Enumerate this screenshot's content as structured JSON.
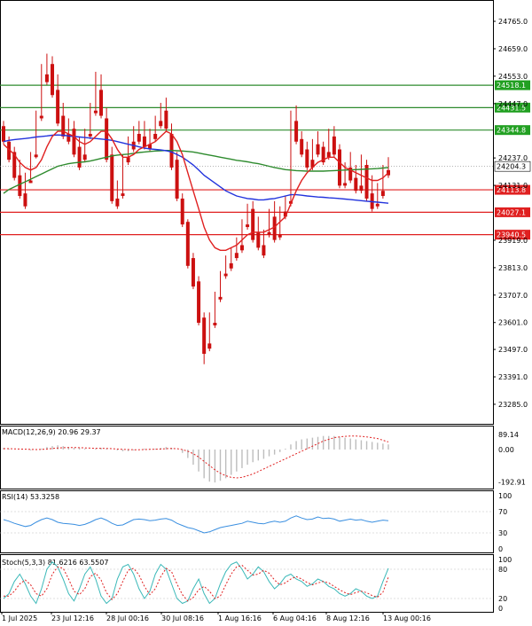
{
  "chart_data": {
    "type": "candlestick",
    "main": {
      "y_ticks": [
        "24765.0",
        "24659.0",
        "24553.0",
        "24447.0",
        "24237.0",
        "24131.0",
        "23919.0",
        "23813.0",
        "23707.0",
        "23601.0",
        "23497.0",
        "23391.0",
        "23285.0"
      ],
      "ylim": [
        23230,
        24820
      ],
      "current_price": "24204.3",
      "levels": [
        {
          "label": "24518.1",
          "value": 24518.1,
          "color": "#2e8b2e",
          "label_color": "#22a022"
        },
        {
          "label": "24431.5",
          "value": 24431.5,
          "color": "#2e8b2e",
          "label_color": "#22a022"
        },
        {
          "label": "24344.8",
          "value": 24344.8,
          "color": "#2e8b2e",
          "label_color": "#22a022"
        },
        {
          "label": "24113.8",
          "value": 24113.8,
          "color": "#e02020",
          "label_color": "#e02020"
        },
        {
          "label": "24027.1",
          "value": 24027.1,
          "color": "#e02020",
          "label_color": "#e02020"
        },
        {
          "label": "23940.5",
          "value": 23940.5,
          "color": "#e02020",
          "label_color": "#e02020"
        }
      ],
      "up_color": "#1f9a1f",
      "down_color": "#cc1010",
      "candles": [
        [
          24360,
          24380,
          24300,
          24290
        ],
        [
          24300,
          24320,
          24230,
          24220
        ],
        [
          24260,
          24280,
          24160,
          24150
        ],
        [
          24170,
          24230,
          24090,
          24080
        ],
        [
          24100,
          24180,
          24050,
          24040
        ],
        [
          24150,
          24260,
          24140,
          24140
        ],
        [
          24250,
          24420,
          24240,
          24235
        ],
        [
          24400,
          24600,
          24390,
          24380
        ],
        [
          24560,
          24640,
          24530,
          24520
        ],
        [
          24600,
          24630,
          24480,
          24470
        ],
        [
          24500,
          24560,
          24370,
          24360
        ],
        [
          24400,
          24450,
          24320,
          24310
        ],
        [
          24330,
          24390,
          24300,
          24290
        ],
        [
          24350,
          24380,
          24250,
          24240
        ],
        [
          24280,
          24320,
          24200,
          24190
        ],
        [
          24250,
          24350,
          24230,
          24220
        ],
        [
          24330,
          24450,
          24320,
          24310
        ],
        [
          24420,
          24570,
          24410,
          24400
        ],
        [
          24500,
          24560,
          24400,
          24390
        ],
        [
          24390,
          24430,
          24230,
          24220
        ],
        [
          24250,
          24280,
          24070,
          24060
        ],
        [
          24080,
          24150,
          24050,
          24040
        ],
        [
          24100,
          24250,
          24090,
          24080
        ],
        [
          24240,
          24320,
          24220,
          24210
        ],
        [
          24300,
          24360,
          24270,
          24260
        ],
        [
          24330,
          24380,
          24300,
          24290
        ],
        [
          24320,
          24380,
          24280,
          24270
        ],
        [
          24290,
          24350,
          24270,
          24260
        ],
        [
          24330,
          24400,
          24310,
          24300
        ],
        [
          24380,
          24450,
          24360,
          24350
        ],
        [
          24420,
          24470,
          24350,
          24340
        ],
        [
          24330,
          24370,
          24200,
          24190
        ],
        [
          24230,
          24260,
          24080,
          24070
        ],
        [
          24080,
          24100,
          23980,
          23970
        ],
        [
          23990,
          24000,
          23820,
          23810
        ],
        [
          23850,
          23870,
          23740,
          23730
        ],
        [
          23760,
          23780,
          23600,
          23590
        ],
        [
          23620,
          23640,
          23480,
          23440
        ],
        [
          23520,
          23640,
          23500,
          23490
        ],
        [
          23600,
          23720,
          23590,
          23580
        ],
        [
          23700,
          23800,
          23690,
          23680
        ],
        [
          23790,
          23860,
          23780,
          23770
        ],
        [
          23830,
          23890,
          23810,
          23800
        ],
        [
          23870,
          23930,
          23850,
          23840
        ],
        [
          23900,
          24000,
          23880,
          23870
        ],
        [
          23980,
          24060,
          23970,
          23960
        ],
        [
          24040,
          24070,
          23920,
          23910
        ],
        [
          23950,
          24010,
          23890,
          23880
        ],
        [
          23900,
          23960,
          23860,
          23850
        ],
        [
          23950,
          24040,
          23940,
          23930
        ],
        [
          24010,
          24070,
          23920,
          23910
        ],
        [
          23940,
          24050,
          23930,
          23920
        ],
        [
          24030,
          24090,
          24010,
          24000
        ],
        [
          24070,
          24420,
          24060,
          24050
        ],
        [
          24380,
          24440,
          24300,
          24290
        ],
        [
          24310,
          24340,
          24250,
          24240
        ],
        [
          24270,
          24300,
          24200,
          24190
        ],
        [
          24230,
          24310,
          24200,
          24190
        ],
        [
          24290,
          24340,
          24250,
          24240
        ],
        [
          24280,
          24300,
          24220,
          24210
        ],
        [
          24260,
          24350,
          24240,
          24230
        ],
        [
          24320,
          24360,
          24250,
          24240
        ],
        [
          24270,
          24290,
          24130,
          24120
        ],
        [
          24140,
          24220,
          24130,
          24120
        ],
        [
          24200,
          24260,
          24150,
          24140
        ],
        [
          24160,
          24210,
          24110,
          24100
        ],
        [
          24130,
          24250,
          24110,
          24100
        ],
        [
          24210,
          24230,
          24080,
          24070
        ],
        [
          24100,
          24170,
          24040,
          24030
        ],
        [
          24060,
          24140,
          24050,
          24040
        ],
        [
          24110,
          24210,
          24090,
          24080
        ],
        [
          24190,
          24240,
          24170,
          24160
        ]
      ],
      "ma_red": [
        24290,
        24270,
        24250,
        24220,
        24200,
        24190,
        24200,
        24230,
        24280,
        24320,
        24340,
        24340,
        24330,
        24320,
        24300,
        24290,
        24300,
        24320,
        24340,
        24340,
        24310,
        24270,
        24240,
        24240,
        24250,
        24270,
        24280,
        24290,
        24300,
        24320,
        24340,
        24330,
        24300,
        24250,
        24180,
        24110,
        24040,
        23970,
        23920,
        23890,
        23880,
        23880,
        23890,
        23900,
        23920,
        23940,
        23950,
        23950,
        23950,
        23960,
        23970,
        23990,
        24010,
        24060,
        24110,
        24150,
        24180,
        24200,
        24220,
        24230,
        24240,
        24240,
        24220,
        24200,
        24190,
        24180,
        24170,
        24160,
        24150,
        24150,
        24160,
        24180
      ],
      "ma_blue": [
        24300,
        24305,
        24308,
        24310,
        24312,
        24315,
        24318,
        24320,
        24322,
        24325,
        24326,
        24325,
        24322,
        24320,
        24318,
        24316,
        24314,
        24312,
        24310,
        24308,
        24305,
        24300,
        24295,
        24290,
        24285,
        24280,
        24275,
        24272,
        24270,
        24268,
        24265,
        24260,
        24250,
        24240,
        24225,
        24210,
        24190,
        24170,
        24155,
        24140,
        24125,
        24110,
        24100,
        24090,
        24085,
        24080,
        24078,
        24075,
        24075,
        24078,
        24080,
        24085,
        24090,
        24095,
        24095,
        24093,
        24090,
        24088,
        24086,
        24085,
        24083,
        24082,
        24080,
        24078,
        24076,
        24074,
        24072,
        24070,
        24068,
        24066,
        24064,
        24062
      ],
      "ma_green": [
        24100,
        24115,
        24125,
        24135,
        24145,
        24155,
        24165,
        24175,
        24185,
        24195,
        24205,
        24210,
        24215,
        24218,
        24220,
        24222,
        24225,
        24230,
        24235,
        24240,
        24245,
        24248,
        24250,
        24252,
        24255,
        24258,
        24260,
        24262,
        24264,
        24265,
        24266,
        24266,
        24265,
        24264,
        24262,
        24260,
        24256,
        24252,
        24248,
        24244,
        24240,
        24236,
        24232,
        24228,
        24225,
        24222,
        24218,
        24215,
        24210,
        24205,
        24200,
        24196,
        24192,
        24190,
        24188,
        24187,
        24186,
        24186,
        24186,
        24186,
        24187,
        24188,
        24189,
        24190,
        24191,
        24192,
        24193,
        24194,
        24195,
        24196,
        24198,
        24200
      ]
    },
    "macd": {
      "label": "MACD(12,26,9) 20.96 29.37",
      "y_ticks": [
        "89.14",
        "0.00",
        "-192.91"
      ],
      "ylim": [
        -210,
        110
      ],
      "hist": [
        10,
        5,
        0,
        0,
        0,
        -5,
        0,
        5,
        15,
        20,
        25,
        20,
        15,
        10,
        10,
        5,
        0,
        5,
        10,
        5,
        0,
        -5,
        -10,
        -10,
        -5,
        0,
        5,
        5,
        5,
        10,
        15,
        10,
        0,
        -20,
        -50,
        -90,
        -130,
        -170,
        -190,
        -195,
        -185,
        -170,
        -150,
        -130,
        -110,
        -90,
        -75,
        -65,
        -55,
        -40,
        -30,
        -15,
        5,
        30,
        50,
        60,
        65,
        70,
        75,
        80,
        80,
        80,
        75,
        70,
        65,
        60,
        55,
        50,
        45,
        40,
        35,
        30
      ],
      "signal": [
        5,
        5,
        4,
        3,
        2,
        1,
        0,
        1,
        3,
        6,
        9,
        11,
        12,
        12,
        11,
        10,
        8,
        7,
        7,
        6,
        5,
        3,
        1,
        0,
        -1,
        -1,
        0,
        1,
        2,
        3,
        5,
        6,
        5,
        0,
        -10,
        -25,
        -45,
        -70,
        -95,
        -120,
        -140,
        -155,
        -165,
        -168,
        -165,
        -155,
        -145,
        -130,
        -115,
        -100,
        -85,
        -70,
        -55,
        -40,
        -25,
        -10,
        5,
        20,
        35,
        50,
        60,
        70,
        75,
        78,
        80,
        80,
        78,
        75,
        70,
        65,
        55,
        45
      ]
    },
    "rsi": {
      "label": "RSI(14) 53.3258",
      "y_ticks": [
        "100",
        "70",
        "30",
        "0"
      ],
      "ylim": [
        0,
        100
      ],
      "values": [
        55,
        52,
        48,
        45,
        42,
        44,
        50,
        55,
        58,
        55,
        50,
        48,
        47,
        46,
        44,
        46,
        50,
        55,
        58,
        54,
        48,
        44,
        45,
        50,
        55,
        56,
        55,
        53,
        54,
        56,
        57,
        54,
        48,
        44,
        40,
        38,
        34,
        30,
        32,
        36,
        40,
        42,
        44,
        46,
        48,
        52,
        50,
        48,
        47,
        50,
        52,
        50,
        52,
        58,
        62,
        58,
        55,
        56,
        60,
        57,
        58,
        56,
        52,
        54,
        56,
        54,
        55,
        52,
        50,
        52,
        54,
        53
      ]
    },
    "stoch": {
      "label": "Stoch(5,3,3) 81.6216 63.5507",
      "y_ticks": [
        "100",
        "80",
        "20",
        "0"
      ],
      "ylim": [
        0,
        100
      ],
      "k": [
        20,
        30,
        55,
        70,
        50,
        25,
        10,
        40,
        80,
        95,
        85,
        60,
        30,
        15,
        40,
        70,
        85,
        60,
        25,
        10,
        20,
        60,
        85,
        90,
        70,
        40,
        20,
        35,
        70,
        90,
        80,
        50,
        20,
        10,
        15,
        40,
        60,
        30,
        10,
        20,
        50,
        75,
        90,
        95,
        80,
        60,
        70,
        85,
        75,
        55,
        40,
        50,
        65,
        70,
        60,
        55,
        45,
        50,
        60,
        55,
        45,
        40,
        30,
        25,
        30,
        40,
        35,
        25,
        20,
        25,
        55,
        82
      ],
      "d": [
        25,
        25,
        35,
        50,
        58,
        48,
        30,
        25,
        40,
        70,
        85,
        82,
        60,
        35,
        28,
        40,
        65,
        72,
        58,
        32,
        18,
        30,
        55,
        78,
        82,
        68,
        45,
        28,
        40,
        65,
        82,
        75,
        50,
        28,
        15,
        22,
        38,
        45,
        35,
        20,
        25,
        48,
        70,
        85,
        88,
        78,
        68,
        70,
        78,
        72,
        58,
        48,
        52,
        60,
        65,
        60,
        53,
        48,
        52,
        55,
        52,
        45,
        38,
        32,
        28,
        32,
        35,
        32,
        26,
        23,
        33,
        64
      ]
    },
    "x_labels": [
      "1 Jul 2025",
      "23 Jul 12:16",
      "28 Jul 00:16",
      "30 Jul 08:16",
      "1 Aug 16:16",
      "6 Aug 04:16",
      "8 Aug 12:16",
      "13 Aug 00:16"
    ]
  }
}
